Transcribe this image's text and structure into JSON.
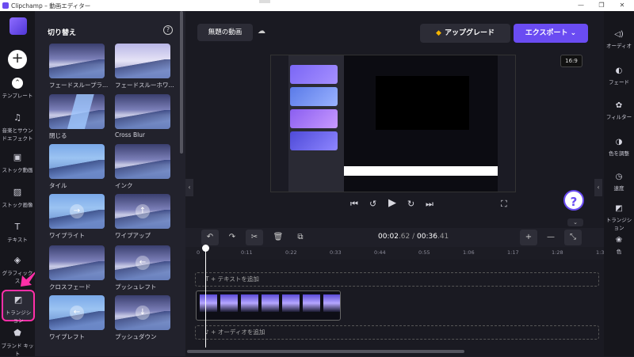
{
  "window": {
    "title": "Clipchamp – 動画エディター",
    "minimize": "—",
    "maximize": "❐",
    "close": "✕"
  },
  "left_nav": {
    "add_label": "+",
    "items": [
      {
        "label": "テンプレート",
        "icon": "template-icon",
        "glyph": "⌃"
      },
      {
        "label": "音楽とサウンドエフェクト",
        "icon": "music-icon",
        "glyph": "♫"
      },
      {
        "label": "ストック動画",
        "icon": "stock-video-icon",
        "glyph": "▣"
      },
      {
        "label": "ストック画像",
        "icon": "stock-image-icon",
        "glyph": "▨"
      },
      {
        "label": "テキスト",
        "icon": "text-icon",
        "glyph": "T"
      },
      {
        "label": "グラフィックス",
        "icon": "graphics-icon",
        "glyph": "◈"
      },
      {
        "label": "トランジション",
        "icon": "transition-icon",
        "glyph": "◩"
      },
      {
        "label": "ブランド キット",
        "icon": "brand-kit-icon",
        "glyph": "⬟"
      }
    ],
    "active_index": 6
  },
  "panel": {
    "title": "切り替え",
    "help": "?",
    "tiles": [
      {
        "label": "フェードスループラ...",
        "style": "dark",
        "glyph": ""
      },
      {
        "label": "フェードスルーホワ...",
        "style": "light",
        "glyph": ""
      },
      {
        "label": "閉じる",
        "style": "stripe",
        "glyph": ""
      },
      {
        "label": "Cross Blur",
        "style": "dark",
        "glyph": ""
      },
      {
        "label": "タイル",
        "style": "blue",
        "glyph": ""
      },
      {
        "label": "インク",
        "style": "dark",
        "glyph": ""
      },
      {
        "label": "ワイプライト",
        "style": "blue",
        "glyph": "→"
      },
      {
        "label": "ワイプアップ",
        "style": "dark",
        "glyph": "↑"
      },
      {
        "label": "クロスフェード",
        "style": "dark",
        "glyph": ""
      },
      {
        "label": "プッシュレフト",
        "style": "dark",
        "glyph": "←"
      },
      {
        "label": "ワイプレフト",
        "style": "blue",
        "glyph": "←"
      },
      {
        "label": "プッシュダウン",
        "style": "dark",
        "glyph": "↓"
      }
    ]
  },
  "header": {
    "project_name": "無題の動画",
    "upgrade_label": "アップグレード",
    "export_label": "エクスポート ⌄"
  },
  "preview": {
    "aspect_ratio": "16:9"
  },
  "player": {
    "skip_back": "⏮",
    "rewind5": "↺",
    "play": "▶",
    "forward5": "↻",
    "skip_forward": "⏭",
    "fullscreen": "⛶"
  },
  "timeline": {
    "current_time": "00:02",
    "current_frac": ".62",
    "total_time": "00:36",
    "total_frac": ".41",
    "separator": " / ",
    "ticks": [
      "0",
      "0:11",
      "0:22",
      "0:33",
      "0:44",
      "0:55",
      "1:06",
      "1:17",
      "1:28",
      "1:39"
    ],
    "text_track": "T  + テキストを追加",
    "audio_track": "♪  + オーディオを追加",
    "clip_frames": 7
  },
  "right_nav": [
    {
      "label": "オーディオ",
      "glyph": "◁)"
    },
    {
      "label": "フェード",
      "glyph": "◐"
    },
    {
      "label": "フィルター",
      "glyph": "✿"
    },
    {
      "label": "色を調整",
      "glyph": "◑"
    },
    {
      "label": "速度",
      "glyph": "◷"
    },
    {
      "label": "トランジション",
      "glyph": "◩"
    },
    {
      "label": "色",
      "glyph": "❀"
    }
  ],
  "colors": {
    "accent": "#6a4cf2",
    "highlight": "#ff2fa8",
    "upgrade_gem": "#f4b400"
  }
}
